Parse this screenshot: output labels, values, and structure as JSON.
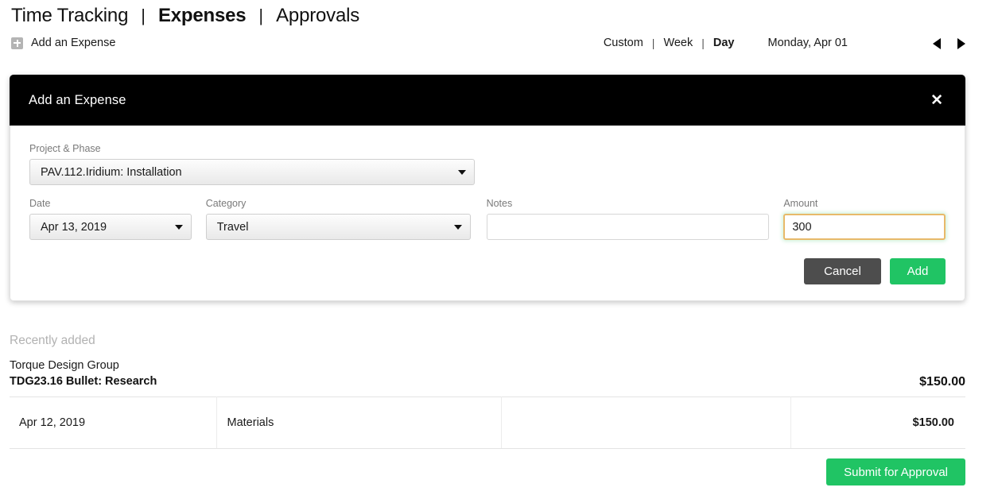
{
  "topnav": {
    "items": [
      {
        "label": "Time Tracking",
        "active": false
      },
      {
        "label": "Expenses",
        "active": true
      },
      {
        "label": "Approvals",
        "active": false
      }
    ],
    "separator": "|"
  },
  "add_expense_link": {
    "label": "Add an Expense",
    "icon": "plus-square-icon"
  },
  "range_controls": {
    "tabs": [
      {
        "label": "Custom",
        "active": false
      },
      {
        "label": "Week",
        "active": false
      },
      {
        "label": "Day",
        "active": true
      }
    ],
    "separator": "|",
    "current_date": "Monday, Apr 01",
    "prev_icon": "triangle-left-icon",
    "next_icon": "triangle-right-icon"
  },
  "modal": {
    "title": "Add an Expense",
    "close_icon": "close-x-icon",
    "fields": {
      "project": {
        "label": "Project & Phase",
        "value": "PAV.112.Iridium: Installation"
      },
      "date": {
        "label": "Date",
        "value": "Apr 13, 2019"
      },
      "category": {
        "label": "Category",
        "value": "Travel"
      },
      "notes": {
        "label": "Notes",
        "value": "",
        "placeholder": ""
      },
      "amount": {
        "label": "Amount",
        "value": "300",
        "placeholder": "",
        "focused": true
      }
    },
    "buttons": {
      "cancel": "Cancel",
      "add": "Add"
    }
  },
  "recent": {
    "title": "Recently added",
    "group": {
      "client": "Torque Design Group",
      "project": "TDG23.16 Bullet: Research",
      "total": "$150.00"
    },
    "rows": [
      {
        "date": "Apr 12, 2019",
        "category": "Materials",
        "notes": "",
        "amount": "$150.00"
      }
    ],
    "submit_label": "Submit for Approval"
  },
  "colors": {
    "accent_green": "#20c464",
    "cancel_gray": "#4d4d4d",
    "modal_header": "#000000",
    "focus_border": "#e8b96a",
    "muted_text": "#b2b2b2"
  }
}
